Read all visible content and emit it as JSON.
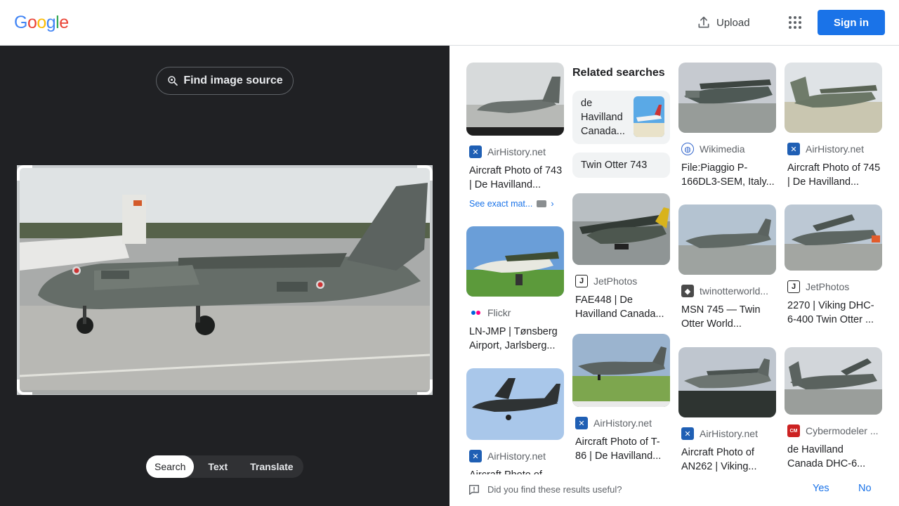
{
  "header": {
    "logo_letters": [
      "G",
      "o",
      "o",
      "g",
      "l",
      "e"
    ],
    "logo_colors": [
      "#4285f4",
      "#ea4335",
      "#fbbc05",
      "#4285f4",
      "#34a853",
      "#ea4335"
    ],
    "upload_label": "Upload",
    "signin_label": "Sign in"
  },
  "lens": {
    "find_source_label": "Find image source",
    "tabs": [
      {
        "label": "Search",
        "active": true
      },
      {
        "label": "Text",
        "active": false
      },
      {
        "label": "Translate",
        "active": false
      }
    ]
  },
  "related": {
    "title": "Related searches",
    "items": [
      {
        "label": "de Havilland Canada..."
      },
      {
        "label": "Twin Otter 743"
      }
    ]
  },
  "results": [
    {
      "source": "AirHistory.net",
      "title": "Aircraft Photo of 743 | De Havilland...",
      "see_exact": "See exact mat..."
    },
    {
      "source": "Flickr",
      "title": "LN-JMP | Tønsberg Airport, Jarlsberg..."
    },
    {
      "source": "AirHistory.net",
      "title": "Aircraft Photo of..."
    },
    {
      "source": "JetPhotos",
      "title": "FAE448 | De Havilland Canada..."
    },
    {
      "source": "AirHistory.net",
      "title": "Aircraft Photo of T-86 | De Havilland..."
    },
    {
      "source": "Wikimedia",
      "title": "File:Piaggio P-166DL3-SEM, Italy..."
    },
    {
      "source": "twinotterworld...",
      "title": "MSN 745 — Twin Otter World..."
    },
    {
      "source": "AirHistory.net",
      "title": "Aircraft Photo of AN262 | Viking..."
    },
    {
      "source": "AirHistory.net",
      "title": "Aircraft Photo of 745 | De Havilland..."
    },
    {
      "source": "JetPhotos",
      "title": "2270 | Viking DHC-6-400 Twin Otter ..."
    },
    {
      "source": "Cybermodeler ...",
      "title": "de Havilland Canada DHC-6..."
    }
  ],
  "feedback": {
    "question": "Did you find these results useful?",
    "yes": "Yes",
    "no": "No"
  }
}
